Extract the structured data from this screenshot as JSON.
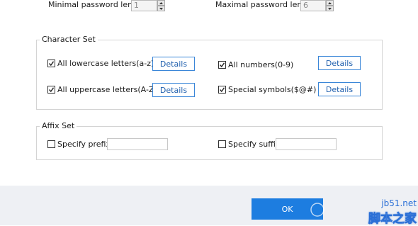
{
  "length": {
    "min_label": "Minimal password length",
    "min_value": "1",
    "max_label": "Maximal password length",
    "max_value": "6"
  },
  "charset": {
    "title": "Character Set",
    "lowercase_label": "All lowercase letters(a-z)",
    "uppercase_label": "All uppercase letters(A-Z)",
    "numbers_label": "All numbers(0-9)",
    "symbols_label": "Special symbols($@#)",
    "details_label": "Details"
  },
  "affix": {
    "title": "Affix Set",
    "prefix_label": "Specify prefix:",
    "prefix_value": "",
    "suffix_label": "Specify suffix:",
    "suffix_value": ""
  },
  "footer": {
    "ok_label": "OK"
  },
  "watermark": {
    "url": "jb51.net",
    "brand": "脚本之家"
  },
  "colors": {
    "accent": "#1d7de0",
    "footer_bg": "#eef0f4",
    "details_border": "#3a86d8"
  }
}
